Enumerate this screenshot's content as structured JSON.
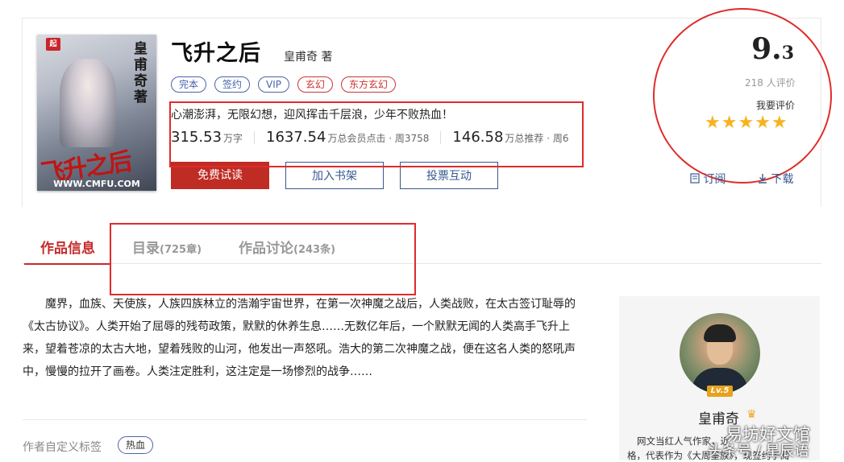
{
  "book": {
    "cover": {
      "logo_text": "起",
      "vertical_title": "皇甫奇著",
      "title_art": "飞升之后",
      "url": "WWW.CMFU.COM"
    },
    "title": "飞升之后",
    "author": "皇甫奇 著",
    "tags": [
      "完本",
      "签约",
      "VIP",
      "玄幻",
      "东方玄幻"
    ],
    "intro": "心潮澎湃，无限幻想，迎风挥击千层浪，少年不败热血！",
    "stats": [
      {
        "value": "315.53",
        "unit": "万字"
      },
      {
        "value": "1637.54",
        "unit": "万总会员点击 · 周3758"
      },
      {
        "value": "146.58",
        "unit": "万总推荐 · 周6"
      }
    ],
    "buttons": {
      "read": "免费试读",
      "shelf": "加入书架",
      "vote": "投票互动"
    }
  },
  "rating": {
    "score_int": "9.",
    "score_dec": "3",
    "count_text": "218 人评价",
    "my_rating": "我要评价",
    "stars": 5,
    "star_glyph": "★",
    "subscribe": "订阅",
    "download": "下载"
  },
  "tabs": [
    {
      "label": "作品信息",
      "count": ""
    },
    {
      "label": "目录",
      "count": "(725章)"
    },
    {
      "label": "作品讨论",
      "count": "(243条)"
    }
  ],
  "description": "魔界，血族、天使族，人族四族林立的浩瀚宇宙世界，在第一次神魔之战后，人类战败，在太古签订耻辱的《太古协议》。人类开始了屈辱的残苟政策，默默的休养生息……无数亿年后，一个默默无闻的人类高手飞升上来，望着苍凉的太古大地，望着残败的山河，他发出一声怒吼。浩大的第二次神魔之战，便在这名人类的怒吼声中，慢慢的拉开了画卷。人类注定胜利，这注定是一场惨烈的战争……",
  "custom_tags": {
    "label": "作者自定义标签",
    "items": [
      "热血"
    ]
  },
  "author_panel": {
    "level": "Lv.5",
    "name": "皇甫奇",
    "bio_line1": "网文当红人气作家，近",
    "bio_line2": "格，代表作为《大周皇族》，现签约于阅"
  },
  "watermark": {
    "line1": "易坊好文馆",
    "line2": "头条号 / 星辰语"
  },
  "colors": {
    "brand_red": "#bf2c24",
    "link_blue": "#39588f",
    "star": "#f6b31f",
    "annotation_red": "#e02b2b"
  }
}
